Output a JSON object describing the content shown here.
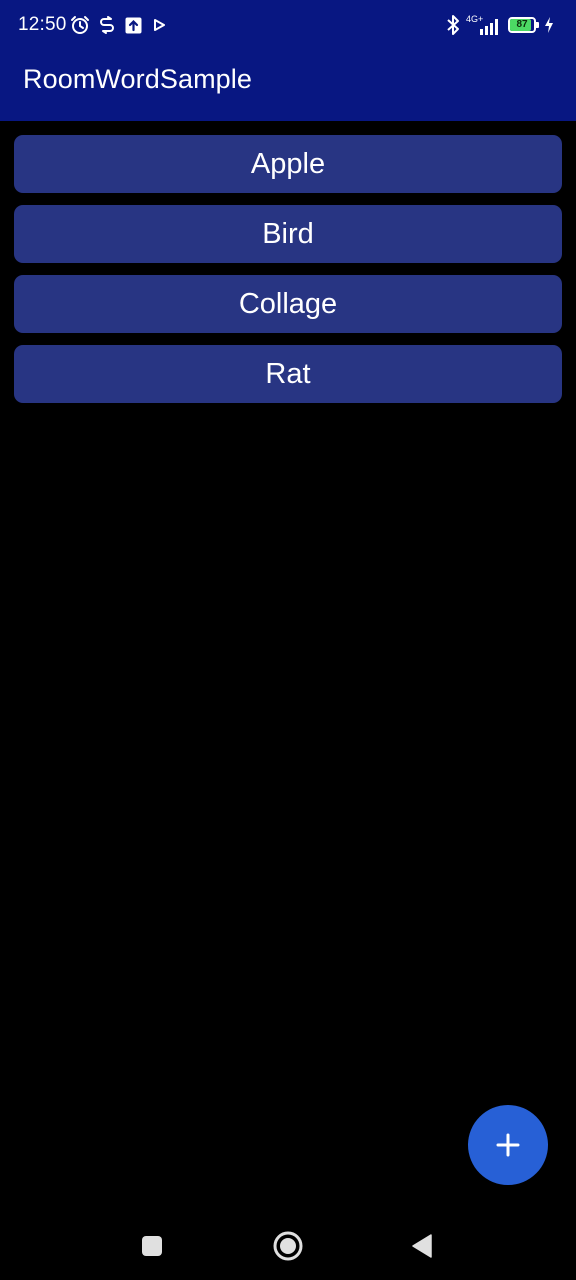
{
  "status_bar": {
    "time": "12:50",
    "network": "4G+",
    "battery_level": "87",
    "battery_fraction": 0.87,
    "icons": [
      "alarm-icon",
      "sync-icon",
      "upload-icon",
      "play-icon",
      "bluetooth-icon",
      "signal-icon",
      "battery-icon",
      "charging-icon"
    ]
  },
  "app_bar": {
    "title": "RoomWordSample"
  },
  "words": [
    {
      "label": "Apple"
    },
    {
      "label": "Bird"
    },
    {
      "label": "Collage"
    },
    {
      "label": "Rat"
    }
  ],
  "fab": {
    "icon": "add-icon",
    "color": "#2760d6"
  },
  "nav_bar": {
    "icons": [
      "recents-square-icon",
      "home-circle-icon",
      "back-triangle-icon"
    ]
  },
  "colors": {
    "app_bar": "#081782",
    "list_item": "#283583",
    "background": "#000000",
    "battery_fill": "#4cd964"
  }
}
